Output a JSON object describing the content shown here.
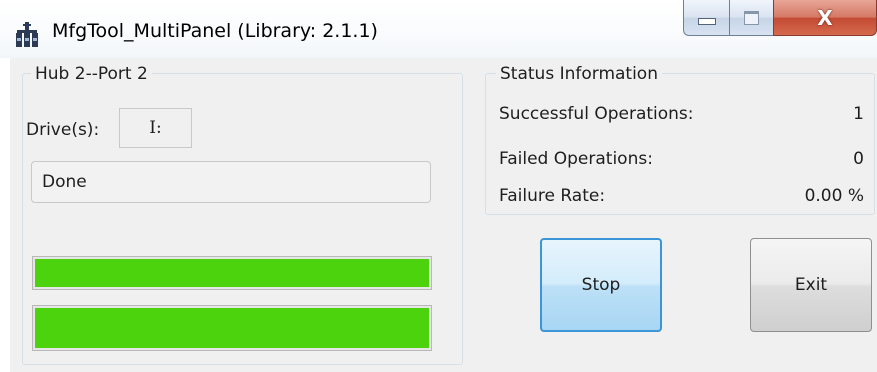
{
  "window": {
    "title": "MfgTool_MultiPanel (Library: 2.1.1)",
    "icon": "usb-hub-icon"
  },
  "caption_buttons": {
    "minimize": "minimize-icon",
    "maximize": "maximize-icon",
    "close_label": "X"
  },
  "hub_panel": {
    "title": "Hub 2--Port 2",
    "drive_label": "Drive(s):",
    "drive_value": "I:",
    "status_text": "Done",
    "progress_bars": [
      {
        "value": 1.0,
        "color": "#4cd30d"
      },
      {
        "value": 1.0,
        "color": "#4cd30d"
      }
    ]
  },
  "status_panel": {
    "title": "Status Information",
    "rows": [
      {
        "label": "Successful Operations:",
        "value": "1"
      },
      {
        "label": "Failed Operations:",
        "value": "0"
      },
      {
        "label": "Failure Rate:",
        "value": "0.00 %"
      }
    ]
  },
  "buttons": {
    "stop_label": "Stop",
    "exit_label": "Exit"
  },
  "colors": {
    "progress_fill": "#4cd30d",
    "focus_border": "#3c95d6",
    "close_button": "#c44a33"
  }
}
